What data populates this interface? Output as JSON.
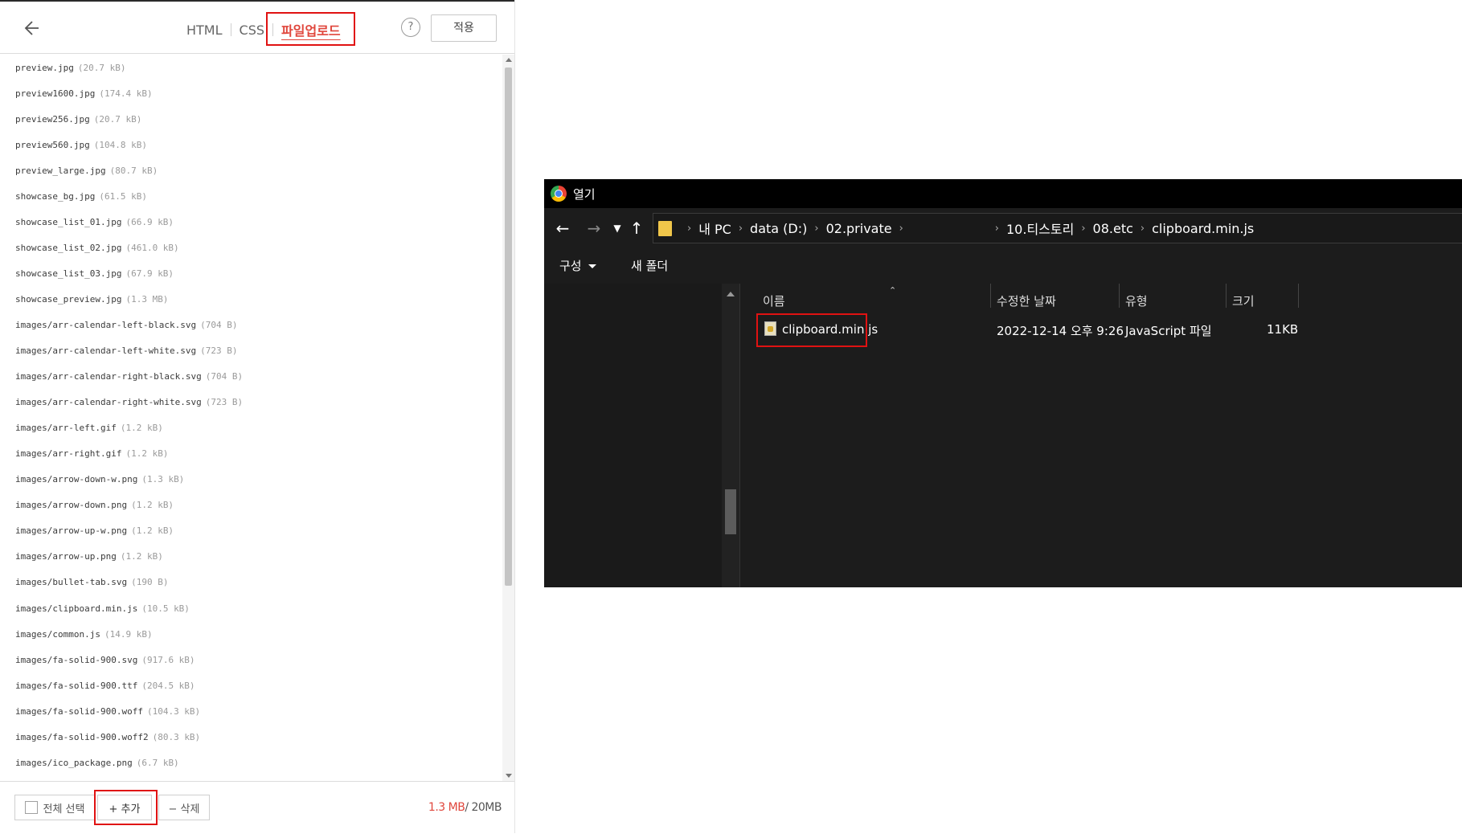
{
  "editor": {
    "tabs": [
      {
        "label": "HTML"
      },
      {
        "label": "CSS"
      },
      {
        "label": "파일업로드"
      }
    ],
    "help_label": "?",
    "apply_label": "적용",
    "files": [
      {
        "name": "preview.jpg",
        "size": "(20.7 kB)"
      },
      {
        "name": "preview1600.jpg",
        "size": "(174.4 kB)"
      },
      {
        "name": "preview256.jpg",
        "size": "(20.7 kB)"
      },
      {
        "name": "preview560.jpg",
        "size": "(104.8 kB)"
      },
      {
        "name": "preview_large.jpg",
        "size": "(80.7 kB)"
      },
      {
        "name": "showcase_bg.jpg",
        "size": "(61.5 kB)"
      },
      {
        "name": "showcase_list_01.jpg",
        "size": "(66.9 kB)"
      },
      {
        "name": "showcase_list_02.jpg",
        "size": "(461.0 kB)"
      },
      {
        "name": "showcase_list_03.jpg",
        "size": "(67.9 kB)"
      },
      {
        "name": "showcase_preview.jpg",
        "size": "(1.3 MB)"
      },
      {
        "name": "images/arr-calendar-left-black.svg",
        "size": "(704 B)"
      },
      {
        "name": "images/arr-calendar-left-white.svg",
        "size": "(723 B)"
      },
      {
        "name": "images/arr-calendar-right-black.svg",
        "size": "(704 B)"
      },
      {
        "name": "images/arr-calendar-right-white.svg",
        "size": "(723 B)"
      },
      {
        "name": "images/arr-left.gif",
        "size": "(1.2 kB)"
      },
      {
        "name": "images/arr-right.gif",
        "size": "(1.2 kB)"
      },
      {
        "name": "images/arrow-down-w.png",
        "size": "(1.3 kB)"
      },
      {
        "name": "images/arrow-down.png",
        "size": "(1.2 kB)"
      },
      {
        "name": "images/arrow-up-w.png",
        "size": "(1.2 kB)"
      },
      {
        "name": "images/arrow-up.png",
        "size": "(1.2 kB)"
      },
      {
        "name": "images/bullet-tab.svg",
        "size": "(190 B)"
      },
      {
        "name": "images/clipboard.min.js",
        "size": "(10.5 kB)"
      },
      {
        "name": "images/common.js",
        "size": "(14.9 kB)"
      },
      {
        "name": "images/fa-solid-900.svg",
        "size": "(917.6 kB)"
      },
      {
        "name": "images/fa-solid-900.ttf",
        "size": "(204.5 kB)"
      },
      {
        "name": "images/fa-solid-900.woff",
        "size": "(104.3 kB)"
      },
      {
        "name": "images/fa-solid-900.woff2",
        "size": "(80.3 kB)"
      },
      {
        "name": "images/ico_package.png",
        "size": "(6.7 kB)"
      }
    ],
    "footer": {
      "select_all_label": "전체 선택",
      "add_label": "+ 추가",
      "delete_label": "− 삭제",
      "quota_used": "1.3 MB",
      "quota_total": "/ 20MB"
    }
  },
  "dialog": {
    "title": "열기",
    "path": [
      "내 PC",
      "data (D:)",
      "02.private",
      "10.티스토리",
      "08.etc",
      "clipboard.min.js"
    ],
    "toolbar": {
      "organize_label": "구성",
      "new_folder_label": "새 폴더"
    },
    "columns": [
      {
        "label": "이름"
      },
      {
        "label": "수정한 날짜"
      },
      {
        "label": "유형"
      },
      {
        "label": "크기"
      }
    ],
    "file": {
      "name": "clipboard.min.js",
      "modified": "2022-12-14 오후 9:26",
      "type": "JavaScript 파일",
      "size": "11KB"
    }
  },
  "colors": {
    "accent": "#e0463c",
    "highlight_box": "#e01212",
    "dialog_bg": "#1c1c1c"
  }
}
